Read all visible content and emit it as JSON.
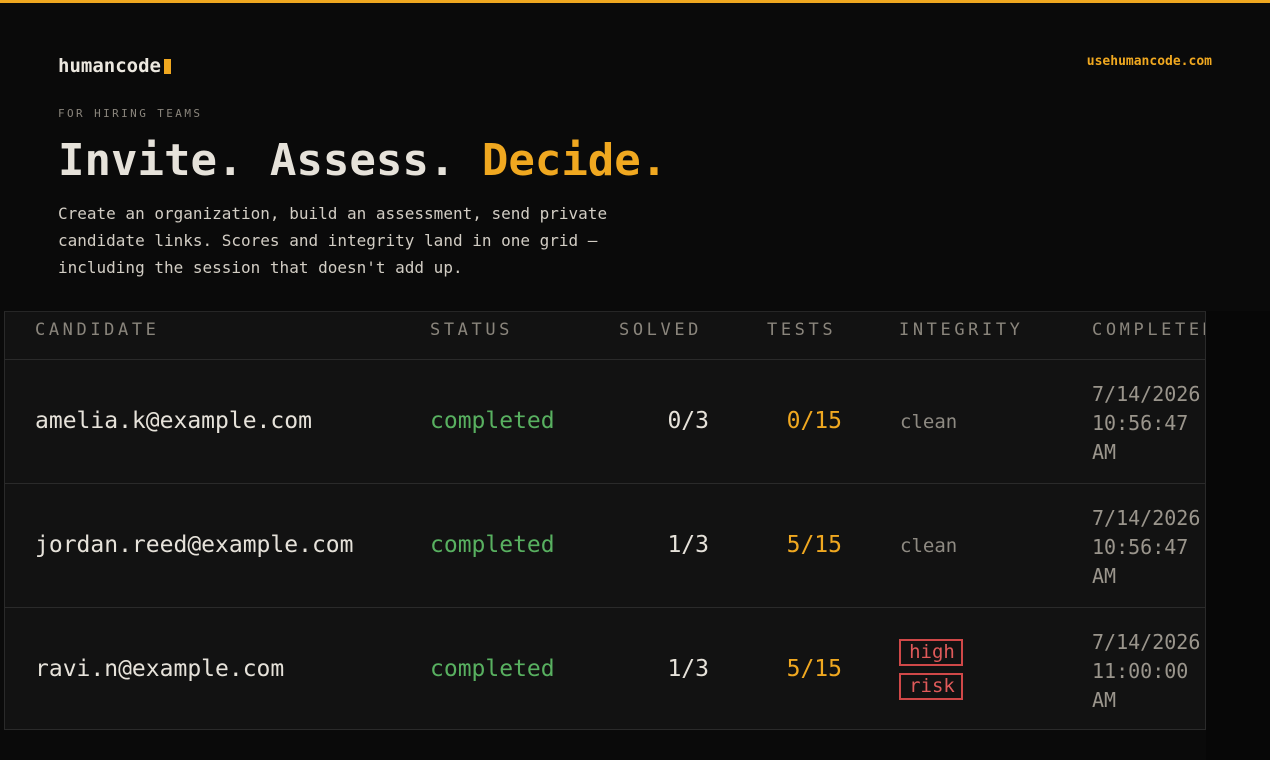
{
  "brand": {
    "name": "humancode"
  },
  "header": {
    "site_link": "usehumancode.com"
  },
  "hero": {
    "eyebrow": "FOR HIRING TEAMS",
    "headline_part1": "Invite. Assess. ",
    "headline_accent": "Decide.",
    "lede": "Create an organization, build an assessment, send private candidate links. Scores and integrity land in one grid — including the session that doesn't add up."
  },
  "table": {
    "columns": [
      "CANDIDATE",
      "STATUS",
      "SOLVED",
      "TESTS",
      "INTEGRITY",
      "COMPLETED"
    ],
    "rows": [
      {
        "candidate": "amelia.k@example.com",
        "status": "completed",
        "solved": "0/3",
        "tests": "0/15",
        "integrity": "clean",
        "completed": "7/14/2026 10:56:47 AM"
      },
      {
        "candidate": "jordan.reed@example.com",
        "status": "completed",
        "solved": "1/3",
        "tests": "5/15",
        "integrity": "clean",
        "completed": "7/14/2026 10:56:47 AM"
      },
      {
        "candidate": "ravi.n@example.com",
        "status": "completed",
        "solved": "1/3",
        "tests": "5/15",
        "integrity": "high risk",
        "integrity_words": [
          "high",
          "risk"
        ],
        "completed": "7/14/2026 11:00:00 AM"
      }
    ]
  },
  "colors": {
    "accent": "#f0a820",
    "success": "#58b060",
    "danger": "#d04848",
    "background": "#0a0a0a"
  }
}
